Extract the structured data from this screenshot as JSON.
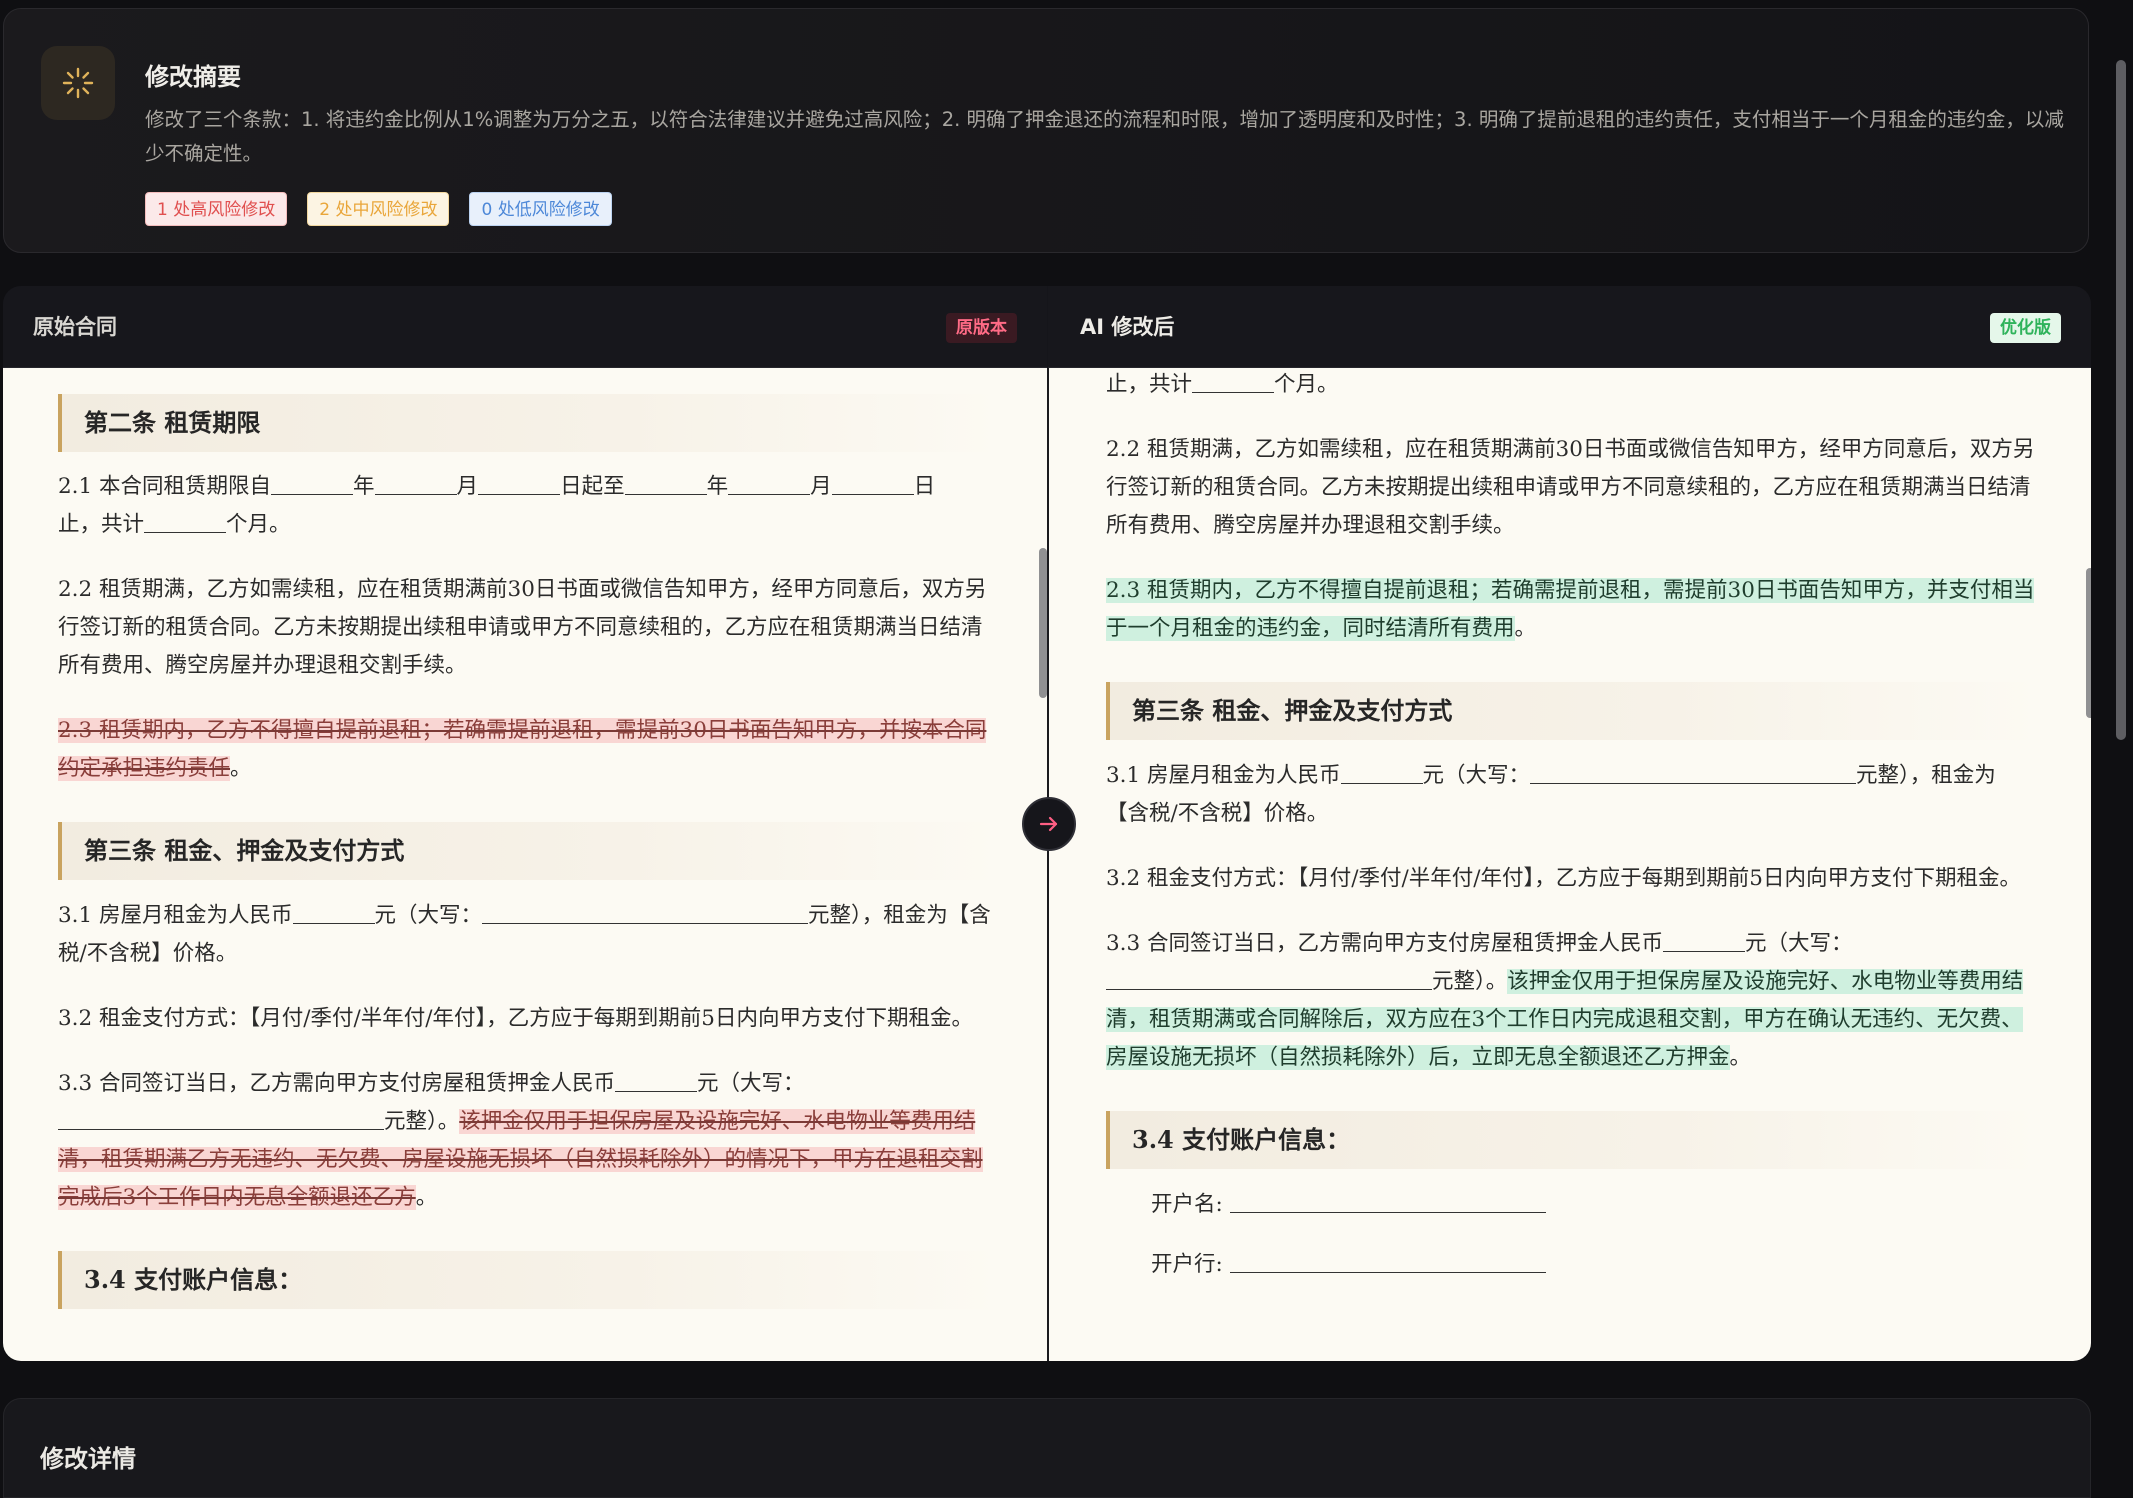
{
  "summary": {
    "icon": "sparkle-icon",
    "title": "修改摘要",
    "text": "修改了三个条款：1. 将违约金比例从1%调整为万分之五，以符合法律建议并避免过高风险；2. 明确了押金退还的流程和时限，增加了透明度和及时性；3. 明确了提前退租的违约责任，支付相当于一个月租金的违约金，以减少不确定性。",
    "badges": {
      "high": "1 处高风险修改",
      "mid": "2 处中风险修改",
      "low": "0 处低风险修改"
    }
  },
  "compare": {
    "left": {
      "title": "原始合同",
      "tag": "原版本",
      "heading2": "第二条 租赁期限",
      "p21a": "2.1 本合同租赁期限自",
      "p21b": "年",
      "p21c": "月",
      "p21d": "日起至",
      "p21e": "年",
      "p21f": "月",
      "p21g": "日",
      "p21h": "止，共计",
      "p21i": "个月。",
      "p22": "2.2 租赁期满，乙方如需续租，应在租赁期满前30日书面或微信告知甲方，经甲方同意后，双方另行签订新的租赁合同。乙方未按期提出续租申请或甲方不同意续租的，乙方应在租赁期满当日结清所有费用、腾空房屋并办理退租交割手续。",
      "p23_del": "2.3 租赁期内，乙方不得擅自提前退租；若确需提前退租，需提前30日书面告知甲方，并按本合同约定承担违约责任",
      "p23_end": "。",
      "heading3": "第三条 租金、押金及支付方式",
      "p31a": "3.1 房屋月租金为人民币",
      "p31b": "元（大写：",
      "p31c": "元整），租金为【含税/不含税】价格。",
      "p32": "3.2 租金支付方式：【月付/季付/半年付/年付】，乙方应于每期到期前5日内向甲方支付下期租金。",
      "p33a": "3.3 合同签订当日，乙方需向甲方支付房屋租赁押金人民币",
      "p33b": "元（大写：",
      "p33c": "元整）。",
      "p33_del": "该押金仅用于担保房屋及设施完好、水电物业等费用结清，租赁期满乙方无违约、无欠费、房屋设施无损坏（自然损耗除外）的情况下，甲方在退租交割完成后3个工作日内无息全额退还乙方",
      "p33_end": "。",
      "heading34": "3.4 支付账户信息："
    },
    "right": {
      "title": "AI 修改后",
      "tag": "优化版",
      "p21h": "止，共计",
      "p21i": "个月。",
      "p22": "2.2 租赁期满，乙方如需续租，应在租赁期满前30日书面或微信告知甲方，经甲方同意后，双方另行签订新的租赁合同。乙方未按期提出续租申请或甲方不同意续租的，乙方应在租赁期满当日结清所有费用、腾空房屋并办理退租交割手续。",
      "p23_ins": "2.3 租赁期内，乙方不得擅自提前退租；若确需提前退租，需提前30日书面告知甲方，并支付相当于一个月租金的违约金，同时结清所有费用",
      "p23_end": "。",
      "heading3": "第三条 租金、押金及支付方式",
      "p31a": "3.1 房屋月租金为人民币",
      "p31b": "元（大写：",
      "p31c": "元整），租金为【含税/不含税】价格。",
      "p32": "3.2 租金支付方式：【月付/季付/半年付/年付】，乙方应于每期到期前5日内向甲方支付下期租金。",
      "p33a": "3.3 合同签订当日，乙方需向甲方支付房屋租赁押金人民币",
      "p33b": "元（大写：",
      "p33c": "元整）。",
      "p33_ins": "该押金仅用于担保房屋及设施完好、水电物业等费用结清，租赁期满或合同解除后，双方应在3个工作日内完成退租交割，甲方在确认无违约、无欠费、房屋设施无损坏（自然损耗除外）后，立即无息全额退还乙方押金",
      "p33_end": "。",
      "heading34": "3.4 支付账户信息：",
      "acct_name": "开户名:",
      "acct_bank": "开户行:"
    }
  },
  "details": {
    "title": "修改详情"
  }
}
